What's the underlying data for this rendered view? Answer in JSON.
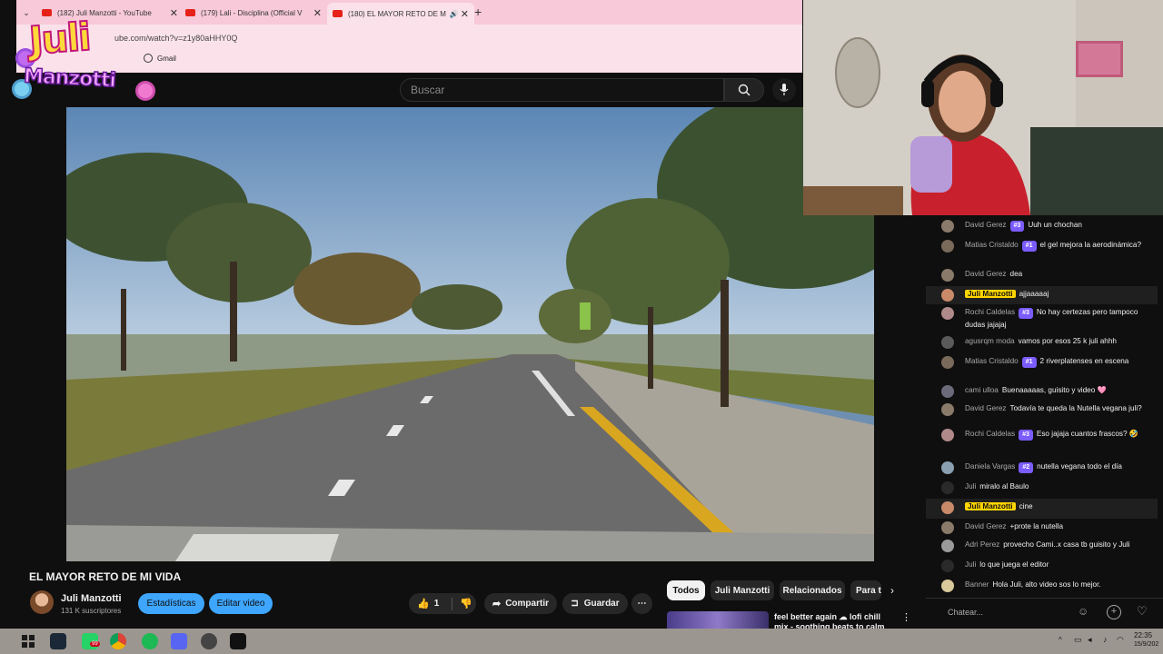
{
  "browser": {
    "tabs": [
      {
        "title": "(182) Juli Manzotti - YouTube"
      },
      {
        "title": "(179) Lali - Disciplina (Official V"
      },
      {
        "title": "(180) EL MAYOR RETO DE M"
      }
    ],
    "new_tab_label": "+",
    "address": "ube.com/watch?v=z1y80aHHY0Q",
    "bookmarks": [
      {
        "label": "Gmail"
      }
    ]
  },
  "overlay_logo": {
    "text_line1": "Juli",
    "text_line2": "Manzotti"
  },
  "youtube": {
    "search_placeholder": "Buscar",
    "video": {
      "title": "EL MAYOR RETO DE MI VIDA",
      "channel": "Juli Manzotti",
      "subscribers": "131 K suscriptores",
      "buttons": {
        "stats": "Estadísticas",
        "edit": "Editar video",
        "share": "Compartir",
        "save": "Guardar"
      },
      "likes": "1"
    },
    "chips": [
      "Todos",
      "Juli Manzotti",
      "Relacionados",
      "Para t"
    ],
    "recommended": [
      {
        "title": "feel better again ☁ lofi chill mix - soothing beats to calm"
      }
    ]
  },
  "chat": {
    "input_placeholder": "Chatear...",
    "messages": [
      {
        "author": "David Gerez",
        "badge": "#3",
        "text": "Uuh un chochan",
        "owner": false,
        "color": "#8a7a6a"
      },
      {
        "author": "Matias Cristaldo",
        "badge": "#1",
        "text": "el gel mejora la aerodinámica?",
        "owner": false,
        "color": "#7a6a5a"
      },
      {
        "author": "David Gerez",
        "badge": "",
        "text": "dea",
        "owner": false,
        "color": "#8a7a6a"
      },
      {
        "author": "Juli Manzotti",
        "badge": "",
        "text": "ajjaaaaaj",
        "owner": true,
        "color": "#c98a6a"
      },
      {
        "author": "Rochi Caldelas",
        "badge": "#3",
        "text": "No hay certezas pero tampoco dudas jajajaj",
        "owner": false,
        "color": "#b08a8a"
      },
      {
        "author": "agusrqm moda",
        "badge": "",
        "text": "vamos por esos 25 k juli ahhh",
        "owner": false,
        "color": "#5a5a5a"
      },
      {
        "author": "Matias Cristaldo",
        "badge": "#1",
        "text": "2 riverplatenses en escena",
        "owner": false,
        "color": "#7a6a5a"
      },
      {
        "author": "cami ulloa",
        "badge": "",
        "text": "Buenaaaaas, guisito y video 🩷",
        "owner": false,
        "color": "#6a6a7a"
      },
      {
        "author": "David Gerez",
        "badge": "",
        "text": "Todavía te queda la Nutella vegana juli?",
        "owner": false,
        "color": "#8a7a6a"
      },
      {
        "author": "Rochi Caldelas",
        "badge": "#3",
        "text": "Eso jajaja cuantos frascos? 🤣",
        "owner": false,
        "color": "#b08a8a"
      },
      {
        "author": "Daniela Vargas",
        "badge": "#2",
        "text": "nutella vegana todo el día",
        "owner": false,
        "color": "#8aa0b0"
      },
      {
        "author": "Juli",
        "badge": "",
        "text": "miralo al Baulo",
        "owner": false,
        "color": "#2a2a2a"
      },
      {
        "author": "Juli Manzotti",
        "badge": "",
        "text": "cine",
        "owner": true,
        "color": "#c98a6a"
      },
      {
        "author": "David Gerez",
        "badge": "",
        "text": "+prote la nutella",
        "owner": false,
        "color": "#8a7a6a"
      },
      {
        "author": "Adri Perez",
        "badge": "",
        "text": "provecho Cami..x casa tb guisito y Juli",
        "owner": false,
        "color": "#9a9a9a"
      },
      {
        "author": "Juli",
        "badge": "",
        "text": "lo que juega el editor",
        "owner": false,
        "color": "#2a2a2a"
      },
      {
        "author": "Banner",
        "badge": "",
        "text": "Hola Juli, alto video sos lo mejor.",
        "owner": false,
        "color": "#d8c89a"
      }
    ]
  },
  "taskbar": {
    "time": "22:35",
    "date": "15/9/202",
    "whatsapp_badge": "99"
  }
}
